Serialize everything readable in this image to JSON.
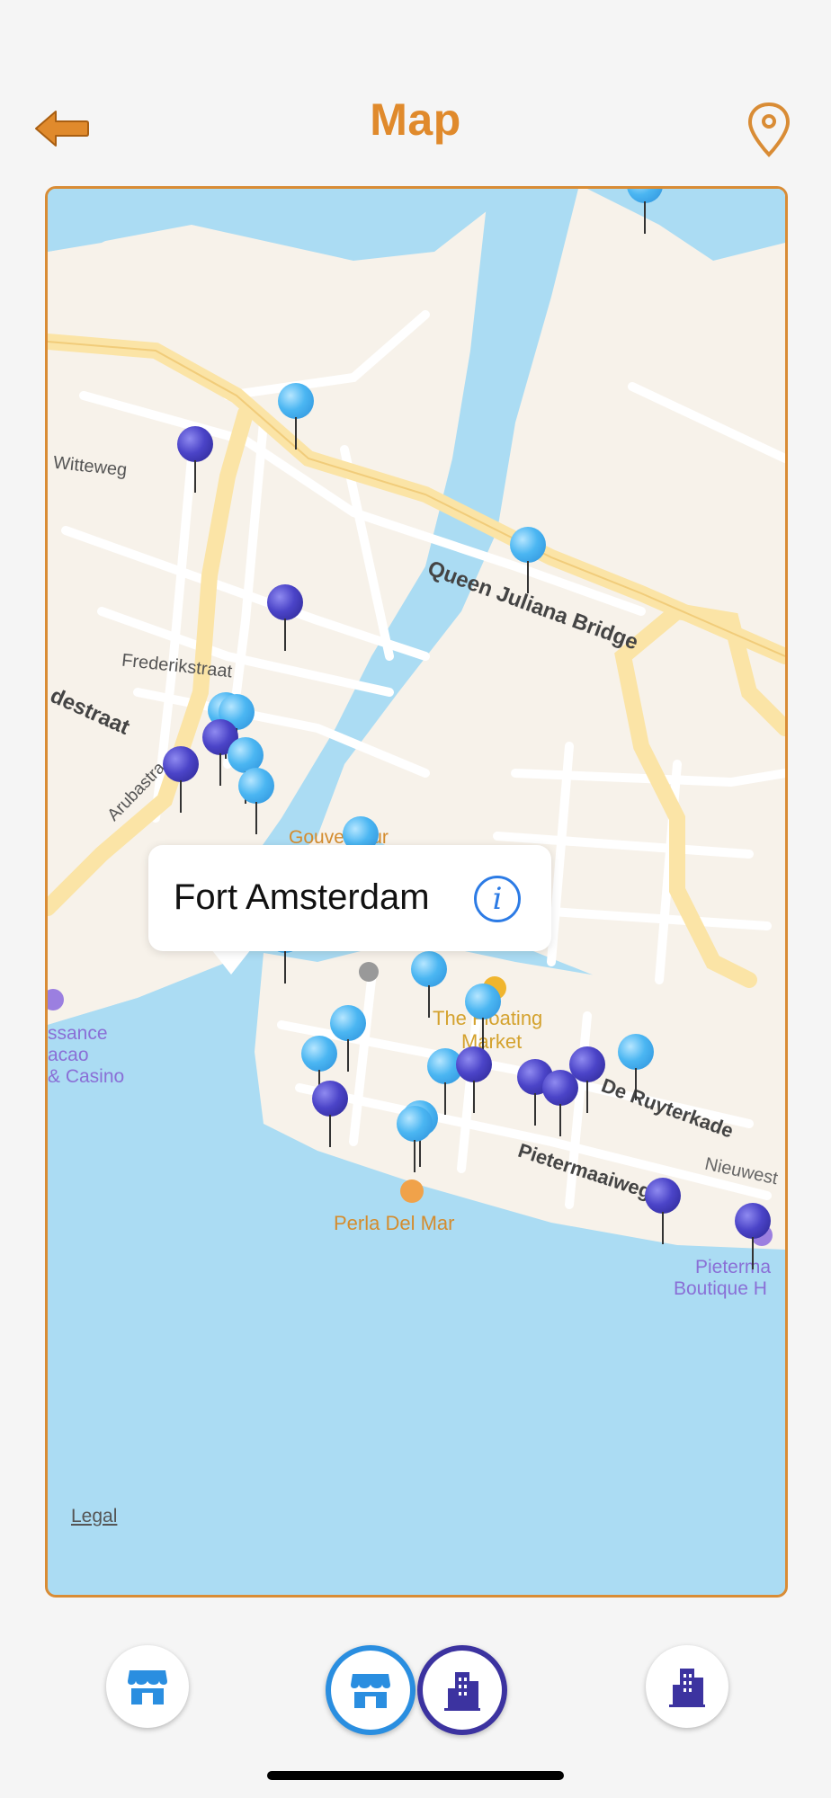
{
  "header": {
    "title": "Map",
    "back_icon": "arrow-left-icon",
    "location_icon": "map-pin-outline-icon",
    "accent_color": "#e08a2c"
  },
  "map": {
    "labels": {
      "witteweg": "Witteweg",
      "frederikstraat": "Frederikstraat",
      "destraat": "destraat",
      "arubastraat": "Arubastra",
      "queen_juliana": "Queen Juliana Bridge",
      "gouverneur": "Gouverneur",
      "floating_market_1": "The Floating",
      "floating_market_2": "Market",
      "ruyterkade": "De Ruyterkade",
      "pietermaaiweg": "Pietermaaiweg",
      "nieuwestr": "Nieuwest",
      "perla": "Perla Del Mar",
      "casino_1": "ssance",
      "casino_2": "acao",
      "casino_3": "& Casino",
      "pietermaai_boutique_1": "Pieterma",
      "pietermaai_boutique_2": "Boutique H"
    },
    "legal_link": "Legal",
    "callout": {
      "title": "Fort Amsterdam",
      "info_icon": "info-circle-icon"
    },
    "pin_colors": {
      "light": "#4bb6f2",
      "dark": "#4b44c8"
    }
  },
  "tabbar": {
    "items": [
      {
        "icon": "store-icon",
        "selected": false
      },
      {
        "icon": "store-icon",
        "selected": true
      },
      {
        "icon": "building-icon",
        "selected": true
      },
      {
        "icon": "building-icon",
        "selected": false
      }
    ]
  }
}
